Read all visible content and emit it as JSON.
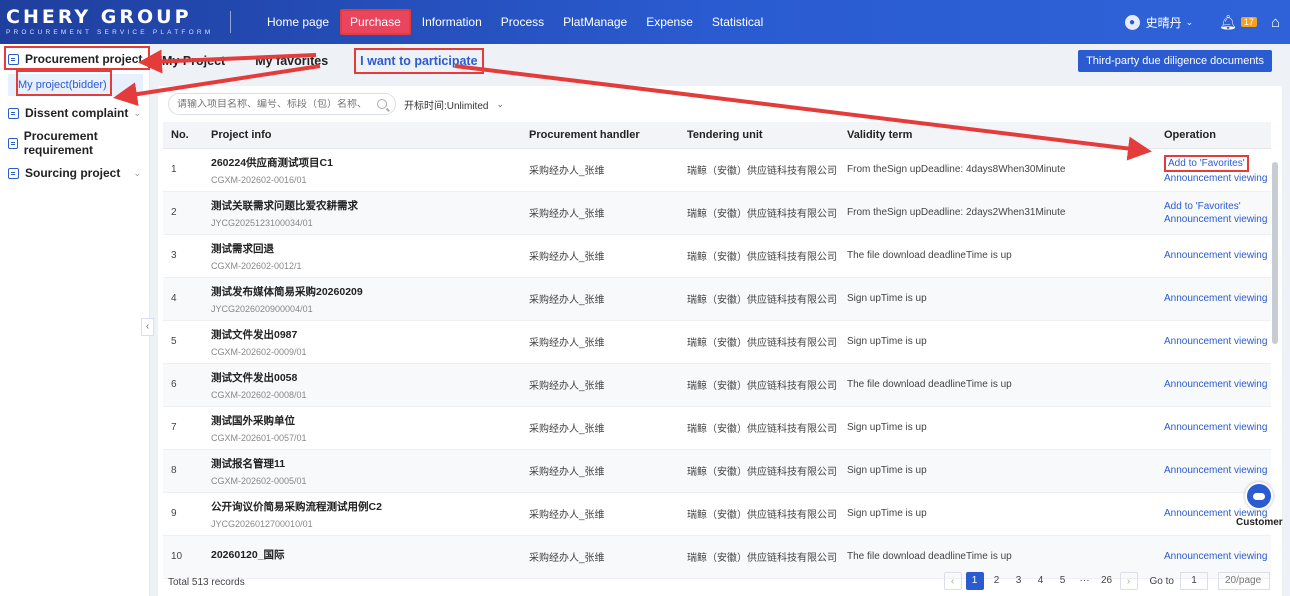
{
  "logo": {
    "main": "CHERY GROUP",
    "sub": "PROCUREMENT SERVICE PLATFORM"
  },
  "nav": [
    "Home page",
    "Purchase",
    "Information",
    "Process",
    "PlatManage",
    "Expense",
    "Statistical"
  ],
  "user": {
    "name": "史晴丹",
    "notifications": "17"
  },
  "sidebar": {
    "items": [
      {
        "label": "Procurement project"
      },
      {
        "label": "Dissent complaint"
      },
      {
        "label": "Procurement requirement"
      },
      {
        "label": "Sourcing project"
      }
    ],
    "sub_item": "My project(bidder)"
  },
  "tabs": [
    "My Project",
    "My favorites",
    "I want to participate"
  ],
  "due_diligence_button": "Third-party due diligence documents",
  "filter": {
    "search_placeholder": "请输入项目名称、编号、标段（包）名称、业主名称",
    "time_label": "开标时间:Unlimited"
  },
  "columns": [
    "No.",
    "Project info",
    "Procurement handler",
    "Tendering unit",
    "Validity term",
    "Operation"
  ],
  "rows": [
    {
      "no": "1",
      "name": "260224供应商测试项目C1",
      "code": "CGXM-202602-0016/01",
      "handler": "采购经办人_张维",
      "unit": "瑞鲸（安徽）供应链科技有限公司",
      "term": "From theSign upDeadline: 4days8When30Minute",
      "fav": "Add to 'Favorites'",
      "ann": "Announcement viewing"
    },
    {
      "no": "2",
      "name": "测试关联需求问题比爱农耕需求",
      "code": "JYCG2025123100034/01",
      "handler": "采购经办人_张维",
      "unit": "瑞鲸（安徽）供应链科技有限公司",
      "term": "From theSign upDeadline: 2days2When31Minute",
      "fav": "Add to 'Favorites'",
      "ann": "Announcement viewing"
    },
    {
      "no": "3",
      "name": "测试需求回退",
      "code": "CGXM-202602-0012/1",
      "handler": "采购经办人_张维",
      "unit": "瑞鲸（安徽）供应链科技有限公司",
      "term": "The file download deadlineTime is up",
      "fav": "",
      "ann": "Announcement viewing"
    },
    {
      "no": "4",
      "name": "测试发布媒体简易采购20260209",
      "code": "JYCG2026020900004/01",
      "handler": "采购经办人_张维",
      "unit": "瑞鲸（安徽）供应链科技有限公司",
      "term": "Sign upTime is up",
      "fav": "",
      "ann": "Announcement viewing"
    },
    {
      "no": "5",
      "name": "测试文件发出0987",
      "code": "CGXM-202602-0009/01",
      "handler": "采购经办人_张维",
      "unit": "瑞鲸（安徽）供应链科技有限公司",
      "term": "Sign upTime is up",
      "fav": "",
      "ann": "Announcement viewing"
    },
    {
      "no": "6",
      "name": "测试文件发出0058",
      "code": "CGXM-202602-0008/01",
      "handler": "采购经办人_张维",
      "unit": "瑞鲸（安徽）供应链科技有限公司",
      "term": "The file download deadlineTime is up",
      "fav": "",
      "ann": "Announcement viewing"
    },
    {
      "no": "7",
      "name": "测试国外采购单位",
      "code": "CGXM-202601-0057/01",
      "handler": "采购经办人_张维",
      "unit": "瑞鲸（安徽）供应链科技有限公司",
      "term": "Sign upTime is up",
      "fav": "",
      "ann": "Announcement viewing"
    },
    {
      "no": "8",
      "name": "测试报名管理11",
      "code": "CGXM-202602-0005/01",
      "handler": "采购经办人_张维",
      "unit": "瑞鲸（安徽）供应链科技有限公司",
      "term": "Sign upTime is up",
      "fav": "",
      "ann": "Announcement viewing"
    },
    {
      "no": "9",
      "name": "公开询议价简易采购流程测试用例C2",
      "code": "JYCG2026012700010/01",
      "handler": "采购经办人_张维",
      "unit": "瑞鲸（安徽）供应链科技有限公司",
      "term": "Sign upTime is up",
      "fav": "",
      "ann": "Announcement viewing"
    },
    {
      "no": "10",
      "name": "20260120_国际",
      "code": "",
      "handler": "采购经办人_张维",
      "unit": "瑞鲸（安徽）供应链科技有限公司",
      "term": "The file download deadlineTime is up",
      "fav": "",
      "ann": "Announcement viewing"
    }
  ],
  "footer": {
    "total": "Total 513 records",
    "pages": [
      "1",
      "2",
      "3",
      "4",
      "5",
      "···",
      "26"
    ],
    "goto_label": "Go to",
    "goto_value": "1",
    "page_size": "20/page"
  },
  "customer_service": "Customer",
  "colors": {
    "brand": "#2a5bd0",
    "highlight": "#e43b3b"
  }
}
